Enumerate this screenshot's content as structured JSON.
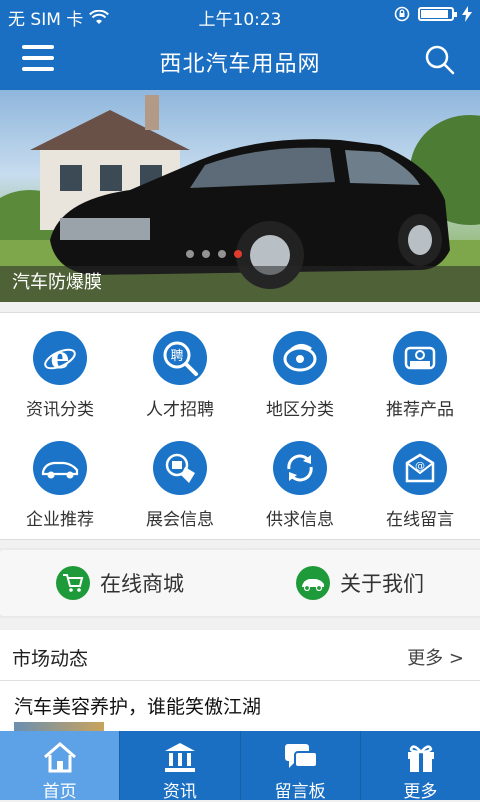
{
  "status_bar": {
    "carrier": "无 SIM 卡",
    "time": "上午10:23",
    "battery_level": 0.85
  },
  "header": {
    "title": "西北汽车用品网",
    "menu_icon": "menu-icon",
    "search_icon": "search-icon"
  },
  "banner": {
    "caption": "汽车防爆膜",
    "slide_count": 4,
    "active_slide": 4
  },
  "categories": [
    {
      "label": "资讯分类",
      "icon": "ie-icon"
    },
    {
      "label": "人才招聘",
      "icon": "recruit-icon"
    },
    {
      "label": "地区分类",
      "icon": "region-icon"
    },
    {
      "label": "推荐产品",
      "icon": "recommend-icon"
    },
    {
      "label": "企业推荐",
      "icon": "car-icon"
    },
    {
      "label": "展会信息",
      "icon": "exhibition-icon"
    },
    {
      "label": "供求信息",
      "icon": "refresh-icon"
    },
    {
      "label": "在线留言",
      "icon": "message-icon"
    }
  ],
  "shortcuts": {
    "shop": {
      "label": "在线商城",
      "icon": "cart-icon"
    },
    "about": {
      "label": "关于我们",
      "icon": "car-icon"
    }
  },
  "news": {
    "title": "市场动态",
    "more": "更多 >",
    "items": [
      "汽车美容养护，谁能笑傲江湖"
    ]
  },
  "tabbar": [
    {
      "label": "首页",
      "icon": "home-icon",
      "active": true
    },
    {
      "label": "资讯",
      "icon": "bank-icon",
      "active": false
    },
    {
      "label": "留言板",
      "icon": "chat-icon",
      "active": false
    },
    {
      "label": "更多",
      "icon": "gift-icon",
      "active": false
    }
  ],
  "colors": {
    "primary": "#1a6fc3",
    "icon_blue": "#1b74c8",
    "icon_green": "#1f9a3a",
    "active_tab": "#5da2e6",
    "active_dot": "#e23b2e"
  }
}
